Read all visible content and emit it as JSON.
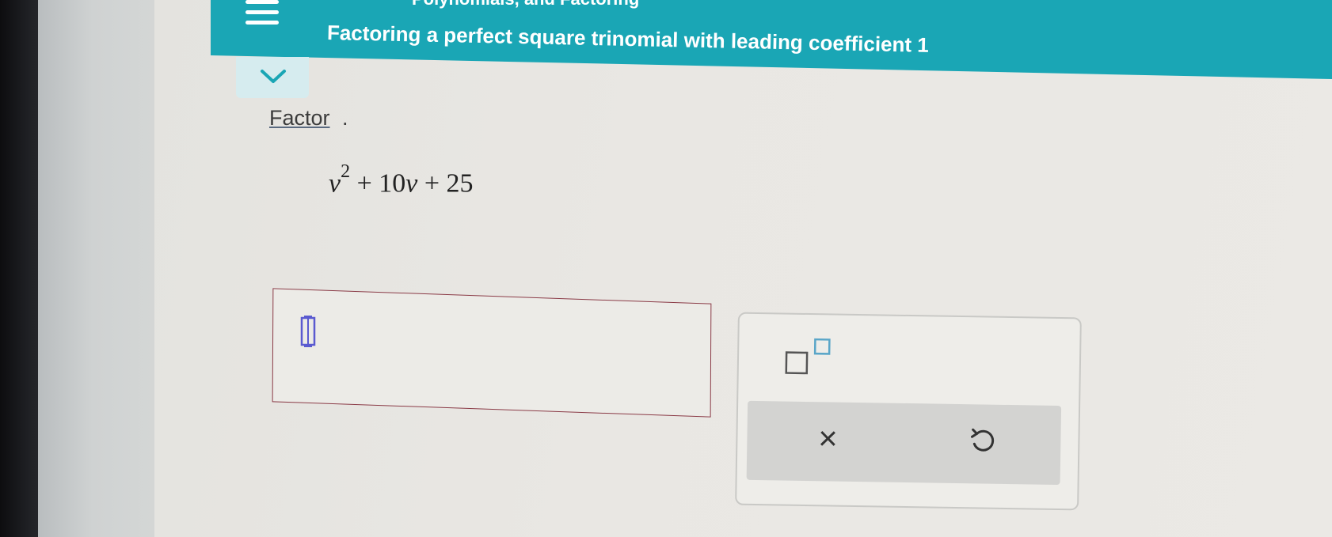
{
  "header": {
    "breadcrumb": "Polynomials, and Factoring",
    "title": "Factoring a perfect square trinomial with leading coefficient 1",
    "accent_color": "#1aa6b5"
  },
  "problem": {
    "instruction": "Factor",
    "instruction_punct": ".",
    "expression": {
      "variable": "v",
      "exponent": "2",
      "middle": " + 10",
      "middle_var": "v",
      "tail": " + 25"
    }
  },
  "answer": {
    "value": ""
  },
  "keypad": {
    "superscript_icon": "superscript-icon",
    "clear_symbol": "×",
    "undo_icon": "undo-icon"
  }
}
